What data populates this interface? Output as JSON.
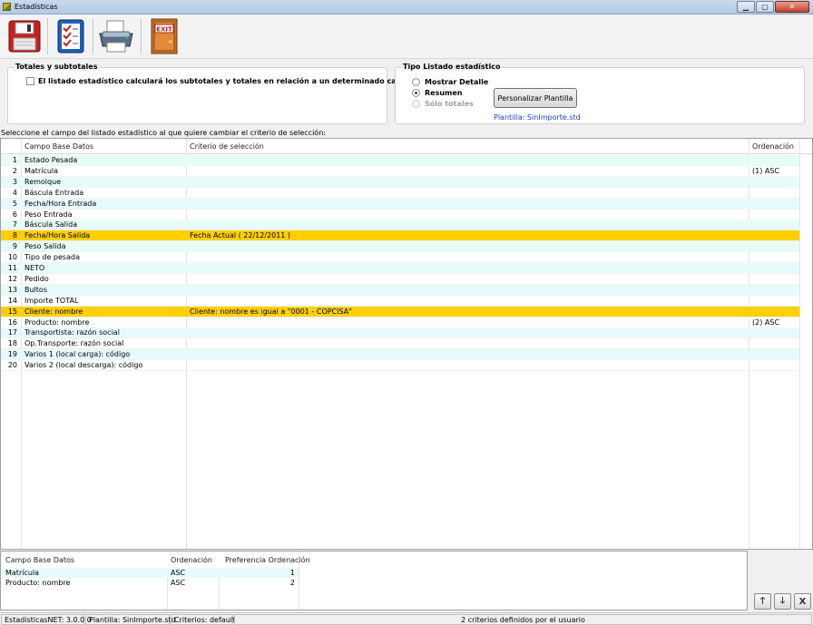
{
  "window": {
    "title": "Estadísticas"
  },
  "toolbar": {
    "buttons": [
      {
        "name": "save",
        "icon": "floppy-disk-icon"
      },
      {
        "name": "criteria",
        "icon": "checklist-icon"
      },
      {
        "name": "print",
        "icon": "printer-icon"
      },
      {
        "name": "exit",
        "icon": "exit-door-icon",
        "label": "EXIT"
      }
    ]
  },
  "totals": {
    "title": "Totales y subtotales",
    "checkbox_label": "El listado estadístico calculará los subtotales y totales en relación a un determinado campo",
    "checked": false
  },
  "tipo": {
    "title": "Tipo Listado estadístico",
    "options": [
      {
        "label": "Mostrar Detalle",
        "selected": false,
        "enabled": true
      },
      {
        "label": "Resumen",
        "selected": true,
        "enabled": true
      },
      {
        "label": "Sólo totales",
        "selected": false,
        "enabled": false
      }
    ],
    "button_label": "Personalizar Plantilla",
    "plantilla_text": "Plantilla: SinImporte.std"
  },
  "instruction": "Seleccione el campo del listado estadístico al que quiere cambiar el criterio de selección:",
  "grid": {
    "columns": [
      "Campo Base Datos",
      "Criterio de selección",
      "Ordenación"
    ],
    "rows": [
      {
        "n": "1",
        "campo": "Estado Pesada",
        "criterio": "",
        "orden": ""
      },
      {
        "n": "2",
        "campo": "Matrícula",
        "criterio": "",
        "orden": "(1) ASC"
      },
      {
        "n": "3",
        "campo": "Remolque",
        "criterio": "",
        "orden": ""
      },
      {
        "n": "4",
        "campo": "Báscula Entrada",
        "criterio": "",
        "orden": ""
      },
      {
        "n": "5",
        "campo": "Fecha/Hora Entrada",
        "criterio": "",
        "orden": ""
      },
      {
        "n": "6",
        "campo": "Peso Entrada",
        "criterio": "",
        "orden": ""
      },
      {
        "n": "7",
        "campo": "Báscula Salida",
        "criterio": "",
        "orden": ""
      },
      {
        "n": "8",
        "campo": "Fecha/Hora Salida",
        "criterio": "Fecha Actual ( 22/12/2011 )",
        "orden": "",
        "highlight": true
      },
      {
        "n": "9",
        "campo": "Peso Salida",
        "criterio": "",
        "orden": ""
      },
      {
        "n": "10",
        "campo": "Tipo de pesada",
        "criterio": "",
        "orden": ""
      },
      {
        "n": "11",
        "campo": "NETO",
        "criterio": "",
        "orden": ""
      },
      {
        "n": "12",
        "campo": "Pedido",
        "criterio": "",
        "orden": ""
      },
      {
        "n": "13",
        "campo": "Bultos",
        "criterio": "",
        "orden": ""
      },
      {
        "n": "14",
        "campo": "Importe TOTAL",
        "criterio": "",
        "orden": ""
      },
      {
        "n": "15",
        "campo": "Cliente: nombre",
        "criterio": "Cliente: nombre es igual a \"0001 - COPCISA\"",
        "orden": "",
        "highlight": true
      },
      {
        "n": "16",
        "campo": "Producto: nombre",
        "criterio": "",
        "orden": "(2) ASC"
      },
      {
        "n": "17",
        "campo": "Transportista: razón social",
        "criterio": "",
        "orden": ""
      },
      {
        "n": "18",
        "campo": "Op.Transporte: razón social",
        "criterio": "",
        "orden": ""
      },
      {
        "n": "19",
        "campo": "Varios 1 (local carga): código",
        "criterio": "",
        "orden": ""
      },
      {
        "n": "20",
        "campo": "Varios 2 (local descarga): código",
        "criterio": "",
        "orden": ""
      }
    ]
  },
  "sort_grid": {
    "columns": [
      "Campo Base Datos",
      "Ordenación",
      "Preferencia Ordenación"
    ],
    "rows": [
      {
        "campo": "Matrícula",
        "orden": "ASC",
        "pref": "1"
      },
      {
        "campo": "Producto: nombre",
        "orden": "ASC",
        "pref": "2"
      }
    ]
  },
  "side_buttons": [
    {
      "name": "move-up",
      "glyph": "🡑",
      "icon": "arrow-up-icon"
    },
    {
      "name": "move-down",
      "glyph": "🡓",
      "icon": "arrow-down-icon"
    },
    {
      "name": "remove",
      "glyph": "X",
      "icon": "close-icon"
    }
  ],
  "status": {
    "version": "EstadisticasNET: 3.0.0.0",
    "plantilla": "Plantilla: SinImporte.std",
    "criterios": "Criterios: default",
    "message": "2 criterios definidos por el usuario"
  }
}
